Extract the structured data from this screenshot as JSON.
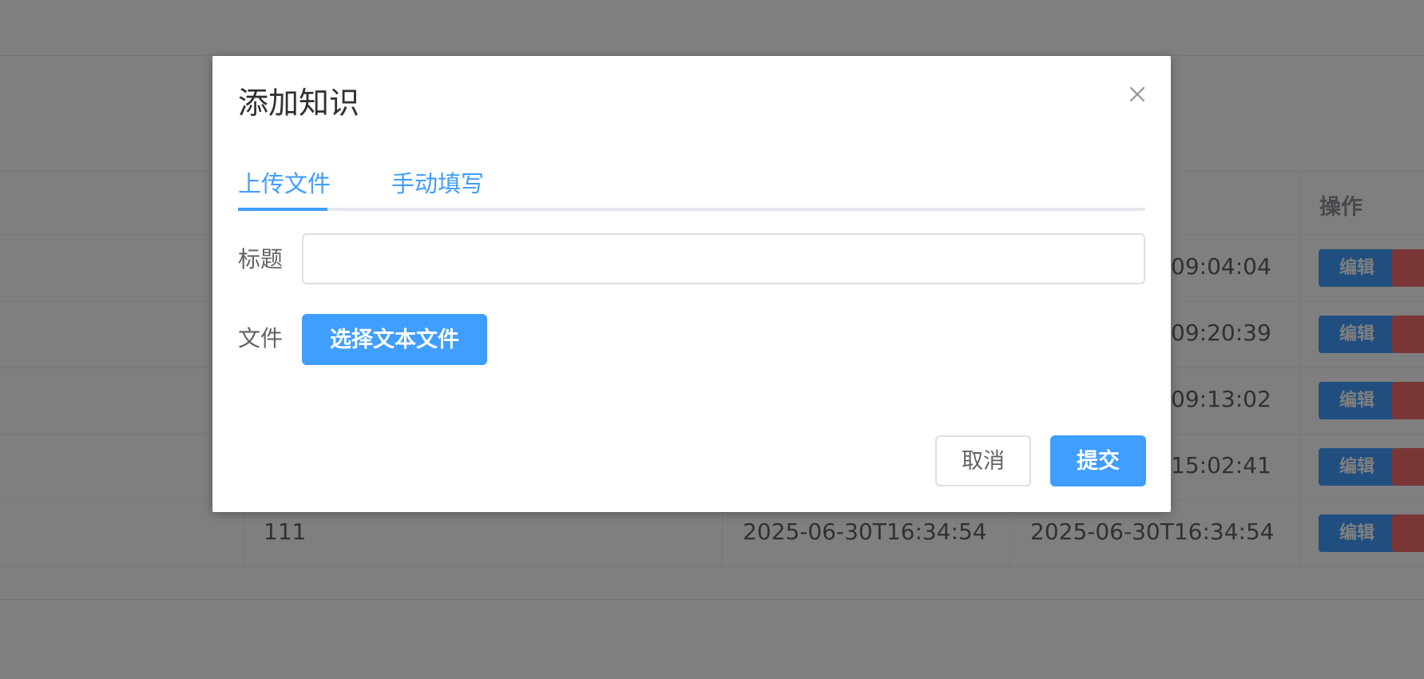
{
  "background": {
    "table": {
      "header": {
        "action_label": "操作"
      },
      "rows": [
        {
          "name": "",
          "created": "",
          "updated": "09:04:04",
          "edit_label": "编辑"
        },
        {
          "name": "",
          "created": "",
          "updated": "09:20:39",
          "edit_label": "编辑"
        },
        {
          "name": "",
          "created": "",
          "updated": "09:13:02",
          "edit_label": "编辑"
        },
        {
          "name": "",
          "created": "",
          "updated": "15:02:41",
          "edit_label": "编辑"
        },
        {
          "name": "111",
          "created": "2025-06-30T16:34:54",
          "updated": "2025-06-30T16:34:54",
          "edit_label": "编辑"
        }
      ]
    }
  },
  "dialog": {
    "title": "添加知识",
    "close_icon": "close-icon",
    "tabs": [
      {
        "label": "上传文件",
        "active": true
      },
      {
        "label": "手动填写",
        "active": false
      }
    ],
    "form": {
      "title_label": "标题",
      "title_value": "",
      "title_placeholder": "",
      "file_label": "文件",
      "choose_file_label": "选择文本文件"
    },
    "footer": {
      "cancel_label": "取消",
      "submit_label": "提交"
    }
  },
  "colors": {
    "primary": "#409eff",
    "danger": "#f56c6c",
    "overlay": "rgba(0,0,0,0.5)"
  }
}
